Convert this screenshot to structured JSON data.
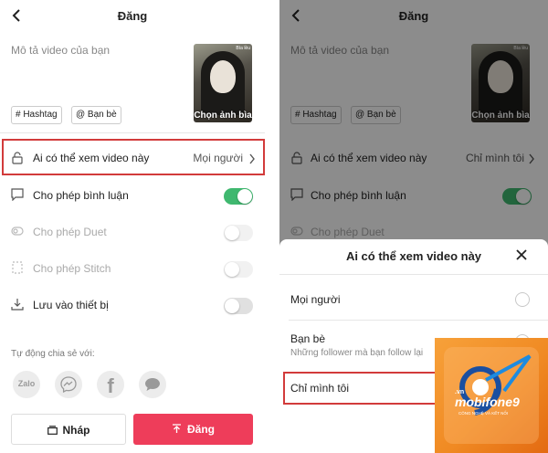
{
  "header": {
    "title": "Đăng"
  },
  "left": {
    "description_placeholder": "Mô tả video của bạn",
    "cover_label": "Chọn ảnh bìa",
    "cover_corner_tag": "Bìa lều",
    "chips": [
      "# Hashtag",
      "@ Bạn bè"
    ],
    "rows": [
      {
        "label": "Ai có thể xem video này",
        "value": "Mọi người"
      },
      {
        "label": "Cho phép bình luận",
        "toggle": "on"
      },
      {
        "label": "Cho phép Duet",
        "toggle": "disabled"
      },
      {
        "label": "Cho phép Stitch",
        "toggle": "disabled"
      },
      {
        "label": "Lưu vào thiết bị",
        "toggle": "off"
      }
    ],
    "share_label": "Tự động chia sẻ với:",
    "share_targets": [
      "Zalo",
      "messenger-icon",
      "facebook-icon",
      "message-icon"
    ],
    "draft_button": "Nháp",
    "post_button": "Đăng"
  },
  "right": {
    "rows": [
      {
        "label": "Ai có thể xem video này",
        "value": "Chỉ mình tôi"
      },
      {
        "label": "Cho phép bình luận"
      },
      {
        "label": "Cho phép Duet"
      }
    ],
    "sheet": {
      "title": "Ai có thể xem video này",
      "options": [
        {
          "label": "Mọi người",
          "sub": ""
        },
        {
          "label": "Bạn bè",
          "sub": "Những follower mà bạn follow lại"
        },
        {
          "label": "Chỉ mình tôi",
          "sub": ""
        }
      ]
    }
  },
  "watermark": {
    "brand": "mobifone9",
    "domain": ".vn",
    "tagline": "CÔNG NGHỆ VÀ KẾT NỐI"
  },
  "colors": {
    "accent": "#ee3d5a",
    "toggle_on": "#3fb86f",
    "highlight": "#d23b3b",
    "logo": "#f08a23"
  }
}
